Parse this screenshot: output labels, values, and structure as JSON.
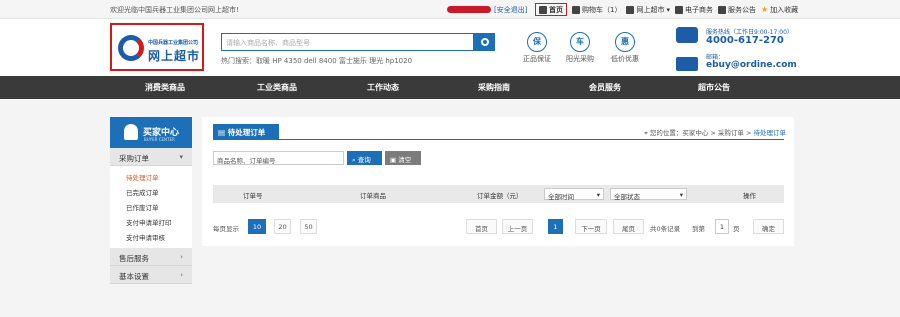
{
  "topbar": {
    "welcome": "欢迎光临中国兵器工业集团公司网上超市!",
    "logout": "[安全退出]",
    "nav": {
      "home": "首页",
      "cart": "购物车（1）",
      "market": "网上超市",
      "ecommerce": "电子商务",
      "service": "服务公告",
      "favorite": "加入收藏"
    }
  },
  "header": {
    "logo_small": "中国兵器工业集团公司",
    "logo_big": "网上超市",
    "search_placeholder": "请输入商品名称、商品型号",
    "hot_search": "热门搜索：取暖  HP 4350  dell 8400  富士施乐  理光  hp1020",
    "features": [
      {
        "icon": "保",
        "label": "正品保证"
      },
      {
        "icon": "车",
        "label": "阳光采购"
      },
      {
        "icon": "惠",
        "label": "低价优惠"
      }
    ],
    "contact": {
      "hours": "服务热线（工作日9:00-17:00）",
      "phone": "4000-617-270",
      "email_label": "邮箱：",
      "email": "ebuy@ordine.com"
    }
  },
  "navbar": [
    "消费类商品",
    "工业类商品",
    "工作动态",
    "采购指南",
    "会员服务",
    "超市公告"
  ],
  "sidebar": {
    "title": "买家中心",
    "subtitle": "BUYER CENTER",
    "sections": [
      {
        "label": "采购订单",
        "chev": "▾",
        "items": [
          "待处理订单",
          "已完成订单",
          "已作废订单",
          "支付申请单打印",
          "支付申请审核"
        ]
      },
      {
        "label": "售后服务",
        "chev": "›",
        "items": []
      },
      {
        "label": "基本设置",
        "chev": "›",
        "items": []
      }
    ]
  },
  "main": {
    "title": "待处理订单",
    "breadcrumb": {
      "prefix": "您的位置：买家中心 > 采购订单 > ",
      "current": "待处理订单"
    },
    "filter_value": "商品名称、订单编号",
    "query_btn": "查询",
    "clear_btn": "清空",
    "table_headers": {
      "order_no": "订单号",
      "goods": "订单商品",
      "amount": "订单金额（元）",
      "time_select": "全部时间",
      "status_select": "全部状态",
      "action": "操作"
    },
    "pager": {
      "per_page_label": "每页显示",
      "sizes": [
        "10",
        "20",
        "50"
      ],
      "first": "首页",
      "prev": "上一页",
      "current": "1",
      "next": "下一页",
      "last": "尾页",
      "total": "共0条记录",
      "jump_label": "到第",
      "jump_value": "1",
      "page_unit": "页",
      "confirm": "确定"
    }
  },
  "colors": {
    "primary": "#1d6fb8",
    "navbar": "#3a3a3a",
    "highlight": "#d21a1a",
    "active": "#e5541c"
  }
}
